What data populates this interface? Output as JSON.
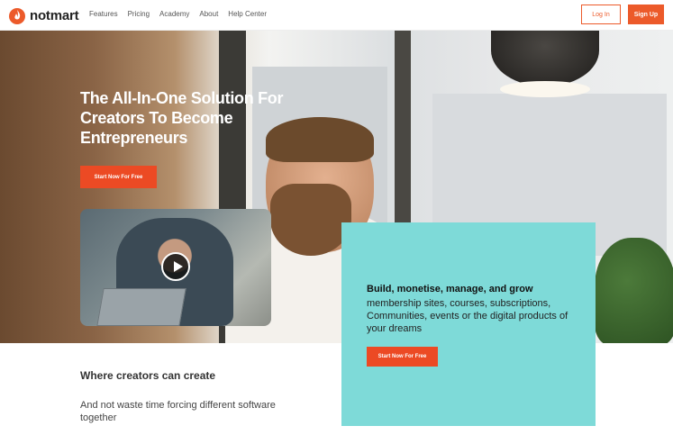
{
  "brand": {
    "name": "notmart",
    "accent": "#ec5a2a"
  },
  "nav": {
    "items": [
      "Features",
      "Pricing",
      "Academy",
      "About",
      "Help Center"
    ]
  },
  "auth": {
    "login": "Log In",
    "signup": "Sign Up"
  },
  "hero": {
    "title": "The All-In-One Solution For Creators To Become Entrepreneurs",
    "cta": "Start Now For Free"
  },
  "feature_card": {
    "heading": "Build, monetise, manage, and grow",
    "body": "membership sites, courses, subscriptions, Communities, events or the digital products of your dreams",
    "cta": "Start Now For Free",
    "color": "#7edad8"
  },
  "section": {
    "title": "Where creators can create",
    "text": "And not waste time forcing different software together"
  },
  "icons": {
    "logo": "flame-icon",
    "video": "play-icon"
  }
}
